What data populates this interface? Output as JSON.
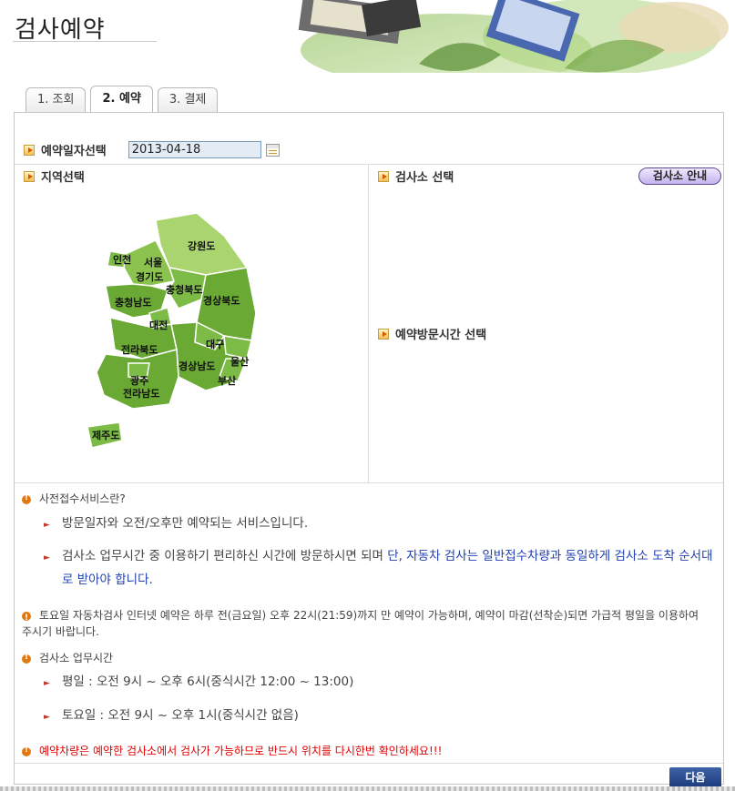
{
  "header": {
    "title": "검사예약"
  },
  "tabs": [
    {
      "label": "1. 조회"
    },
    {
      "label": "2. 예약"
    },
    {
      "label": "3. 결제"
    }
  ],
  "date_selection": {
    "label": "예약일자선택",
    "value": "2013-04-18"
  },
  "region": {
    "label": "지역선택",
    "map_labels": {
      "gangwon": "강원도",
      "incheon": "인천",
      "seoul": "서울",
      "gyeonggi": "경기도",
      "chungbuk": "충청북도",
      "gyeongbuk": "경상북도",
      "chungnam": "충청남도",
      "daejeon": "대전",
      "daegu": "대구",
      "jeonbuk": "전라북도",
      "ulsan": "울산",
      "gyeongnam": "경상남도",
      "gwangju": "광주",
      "busan": "부산",
      "jeonnam": "전라남도",
      "jeju": "제주도"
    }
  },
  "center": {
    "label": "검사소 선택",
    "guide_button": "검사소 안내"
  },
  "visit_time": {
    "label": "예약방문시간 선택"
  },
  "notes": {
    "pre_service": {
      "title": "사전접수서비스란?",
      "item1": "방문일자와 오전/오후만 예약되는 서비스입니다.",
      "item2_plain": "검사소 업무시간 중 이용하기 편리하신 시간에 방문하시면 되며 ",
      "item2_blue": "단, 자동차 검사는 일반접수차량과 동일하게 검사소 도착 순서대로 받아야 합니다."
    },
    "saturday": "토요일 자동차검사 인터넷 예약은 하루 전(금요일) 오후 22시(21:59)까지 만 예약이 가능하며, 예약이 마감(선착순)되면 가급적 평일을 이용하여 주시기 바랍니다.",
    "hours": {
      "title": "검사소 업무시간",
      "weekday": "평일 : 오전 9시 ~ 오후 6시(중식시간 12:00 ~ 13:00)",
      "saturday": "토요일 : 오전 9시 ~ 오후 1시(중식시간 없음)"
    },
    "warning": "예약차량은 예약한 검사소에서 검사가 가능하므로 반드시 위치를 다시한번 확인하세요!!!"
  },
  "next_button": "다음",
  "colors": {
    "map_green": "#6aa934",
    "map_light": "#a9d46e",
    "button_blue": "#1c3c7c",
    "warning_red": "#e00000"
  }
}
